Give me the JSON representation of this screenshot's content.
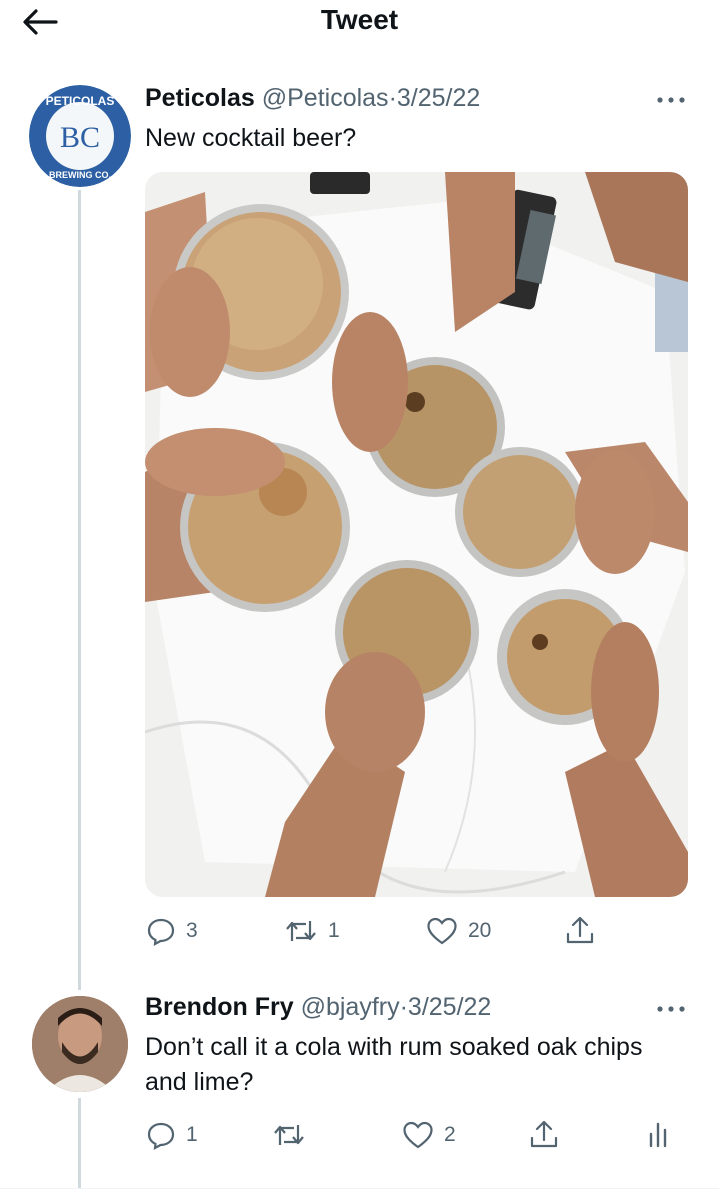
{
  "header": {
    "title": "Tweet",
    "back_icon": "arrow-left-icon"
  },
  "tweet": {
    "display_name": "Peticolas",
    "handle": "@Peticolas",
    "separator": "·",
    "date": "3/25/22",
    "text": "New cocktail beer?",
    "avatar": {
      "logo_text": "PETICOLAS BREWING COMPANY",
      "monogram": "BC",
      "color": "#2c5fa3"
    },
    "image_description_alt": "Six hands holding glasses of foamy brown drinks over a white tablecloth",
    "stats": {
      "replies": "3",
      "retweets": "1",
      "likes": "20"
    }
  },
  "reply": {
    "display_name": "Brendon Fry",
    "handle": "@bjayfry",
    "separator": "·",
    "date": "3/25/22",
    "text": "Don’t call it a cola with rum soaked oak chips and lime?",
    "stats": {
      "replies": "1",
      "retweets": "",
      "likes": "2"
    }
  },
  "icons": [
    "arrow-left-icon",
    "more-icon",
    "reply-icon",
    "retweet-icon",
    "like-icon",
    "share-icon",
    "analytics-icon"
  ],
  "colors": {
    "text": "#0f1419",
    "secondary": "#536471",
    "thread_line": "#cfd9de",
    "logo_blue": "#2c5fa3"
  }
}
